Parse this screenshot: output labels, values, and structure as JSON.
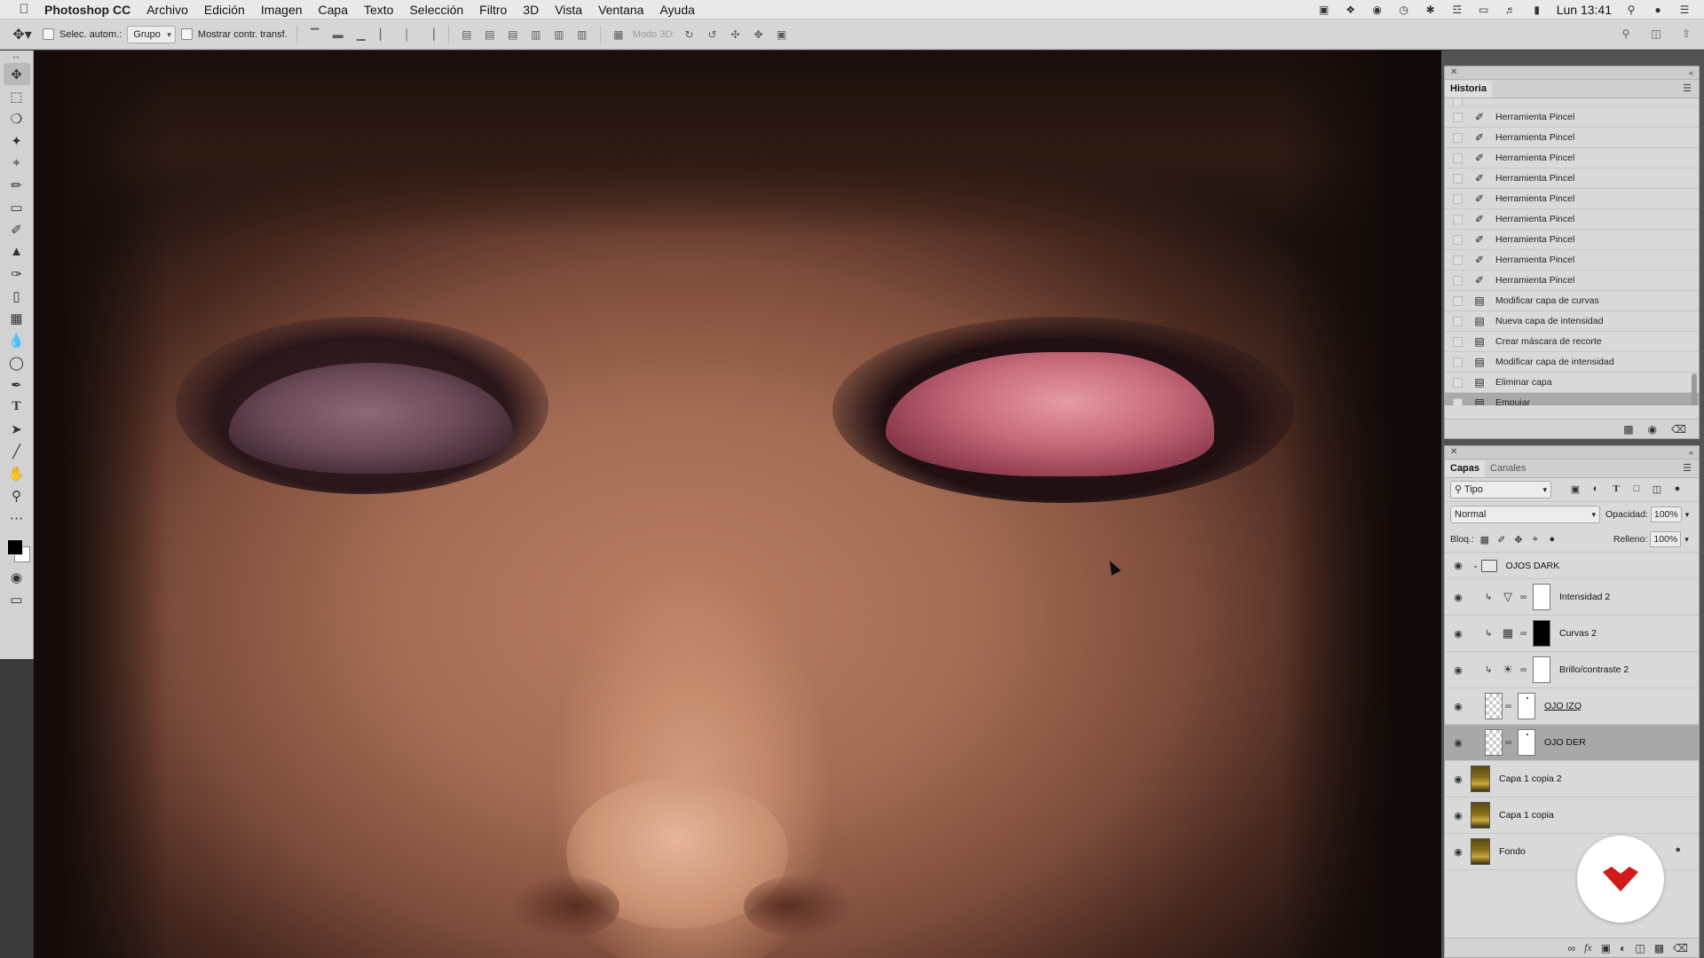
{
  "menubar": {
    "app_name": "Photoshop CC",
    "menus": [
      "Archivo",
      "Edición",
      "Imagen",
      "Capa",
      "Texto",
      "Selección",
      "Filtro",
      "3D",
      "Vista",
      "Ventana",
      "Ayuda"
    ],
    "clock": "Lun 13:41"
  },
  "options": {
    "auto_select_label": "Selec. autom.:",
    "auto_select_value": "Grupo",
    "show_transform_label": "Mostrar contr. transf.",
    "mode3d_label": "Modo 3D:"
  },
  "history": {
    "tab": "Historia",
    "items": [
      {
        "label": "Herramienta Pincel",
        "icon": "brush-icon"
      },
      {
        "label": "Herramienta Pincel",
        "icon": "brush-icon"
      },
      {
        "label": "Herramienta Pincel",
        "icon": "brush-icon"
      },
      {
        "label": "Herramienta Pincel",
        "icon": "brush-icon"
      },
      {
        "label": "Herramienta Pincel",
        "icon": "brush-icon"
      },
      {
        "label": "Herramienta Pincel",
        "icon": "brush-icon"
      },
      {
        "label": "Herramienta Pincel",
        "icon": "brush-icon"
      },
      {
        "label": "Herramienta Pincel",
        "icon": "brush-icon"
      },
      {
        "label": "Herramienta Pincel",
        "icon": "brush-icon"
      },
      {
        "label": "Modificar capa de curvas",
        "icon": "document-icon"
      },
      {
        "label": "Nueva capa de intensidad",
        "icon": "document-icon"
      },
      {
        "label": "Crear máscara de recorte",
        "icon": "document-icon"
      },
      {
        "label": "Modificar capa de intensidad",
        "icon": "document-icon"
      },
      {
        "label": "Eliminar capa",
        "icon": "document-icon"
      },
      {
        "label": "Empujar",
        "icon": "document-icon"
      }
    ]
  },
  "layers": {
    "tabs": [
      "Capas",
      "Canales"
    ],
    "filter_kind": "Tipo",
    "blend_mode": "Normal",
    "opacity_label": "Opacidad:",
    "opacity_value": "100%",
    "lock_label": "Bloq.:",
    "fill_label": "Relleno:",
    "fill_value": "100%",
    "group_name": "OJOS DARK",
    "items": [
      {
        "name": "Intensidad 2"
      },
      {
        "name": "Curvas 2"
      },
      {
        "name": "Brillo/contraste 2"
      },
      {
        "name": "OJO IZQ"
      },
      {
        "name": "OJO DER"
      },
      {
        "name": "Capa 1 copia 2"
      },
      {
        "name": "Capa 1 copia"
      },
      {
        "name": "Fondo"
      }
    ]
  },
  "colors": {
    "brand_red": "#d11a1a",
    "selected_row": "#a8a8a8"
  }
}
